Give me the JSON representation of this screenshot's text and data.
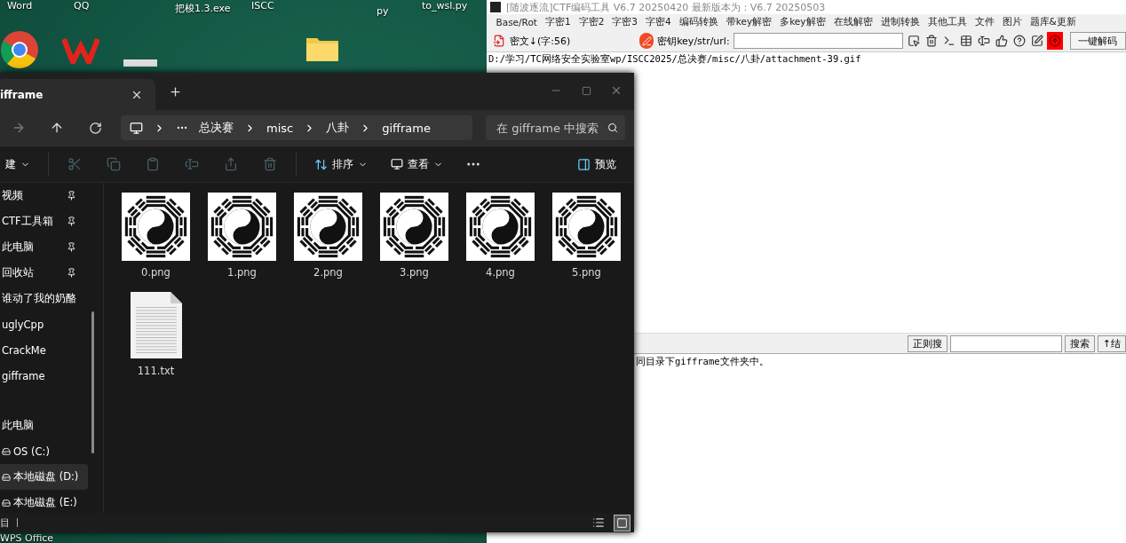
{
  "desktop": {
    "icon_labels": [
      "Word",
      "QQ",
      "把梭1.3.exe",
      "ISCC",
      "py",
      "to_wsl.py"
    ],
    "bottom_label": "WPS Office"
  },
  "ctf_window": {
    "title": "[随波逐流]CTF编码工具 V6.7 20250420    最新版本为：V6.7  20250503",
    "menu": [
      "Base/Rot",
      "字密1",
      "字密2",
      "字密3",
      "字密4",
      "编码转换",
      "带key解密",
      "多key解密",
      "在线解密",
      "进制转换",
      "其他工具",
      "文件",
      "图片",
      "题库&更新"
    ],
    "toolbar": {
      "ciphertext_label": "密文↓(字:56)",
      "key_label": "密钥key/str/url:",
      "decode_button": "一键解码"
    },
    "path_text": "D:/学习/TC网络安全实验室wp/ISCC2025/总决赛/misc/八卦/attachment-39.gif",
    "search_bar": {
      "regex_button": "正则搜",
      "search_button": "搜索",
      "result_button": "↑结"
    },
    "output_text": "同目录下gifframe文件夹中。"
  },
  "explorer": {
    "tab": {
      "title": "ifframe"
    },
    "breadcrumb": [
      "总决赛",
      "misc",
      "八卦",
      "gifframe"
    ],
    "search_placeholder": "在 gifframe 中搜索",
    "commands": {
      "new": "建",
      "actions_disabled": true,
      "sort": "排序",
      "view": "查看",
      "preview": "预览"
    },
    "sidebar": {
      "quick_access": [
        {
          "label": "视频",
          "pinned": true,
          "selected": false
        },
        {
          "label": "CTF工具箱",
          "pinned": true,
          "selected": false
        },
        {
          "label": "此电脑",
          "pinned": true,
          "selected": false
        },
        {
          "label": "回收站",
          "pinned": true,
          "selected": false
        },
        {
          "label": "谁动了我的奶酪",
          "pinned": false,
          "selected": false
        },
        {
          "label": "uglyCpp",
          "pinned": false,
          "selected": false
        },
        {
          "label": "CrackMe",
          "pinned": false,
          "selected": false
        },
        {
          "label": "gifframe",
          "pinned": false,
          "selected": false
        }
      ],
      "devices": [
        {
          "label": "此电脑",
          "kind": "computer",
          "selected": false
        },
        {
          "label": "OS (C:)",
          "kind": "drive",
          "selected": false
        },
        {
          "label": "本地磁盘 (D:)",
          "kind": "drive",
          "selected": true
        },
        {
          "label": "本地磁盘 (E:)",
          "kind": "drive",
          "selected": false
        }
      ]
    },
    "files": [
      {
        "name": "0.png",
        "kind": "image"
      },
      {
        "name": "1.png",
        "kind": "image"
      },
      {
        "name": "2.png",
        "kind": "image"
      },
      {
        "name": "3.png",
        "kind": "image"
      },
      {
        "name": "4.png",
        "kind": "image"
      },
      {
        "name": "5.png",
        "kind": "image"
      },
      {
        "name": "111.txt",
        "kind": "text"
      }
    ],
    "status_bar": {
      "text": "目",
      "views": [
        {
          "kind": "details",
          "selected": false
        },
        {
          "kind": "large_icons",
          "selected": true
        }
      ]
    }
  }
}
